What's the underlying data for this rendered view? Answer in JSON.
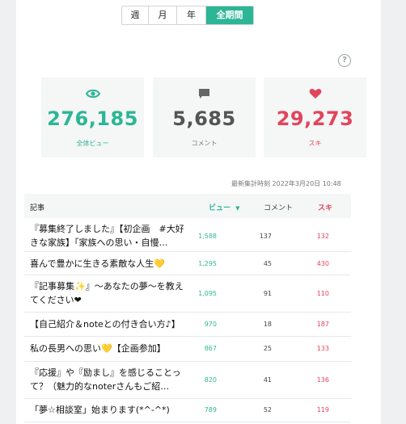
{
  "tabs": [
    {
      "label": "週",
      "active": false
    },
    {
      "label": "月",
      "active": false
    },
    {
      "label": "年",
      "active": false
    },
    {
      "label": "全期間",
      "active": true
    }
  ],
  "help": {
    "label": "?"
  },
  "stats": [
    {
      "value": "276,185",
      "label": "全体ビュー",
      "icon": "eye-icon",
      "color": "#2cb696"
    },
    {
      "value": "5,685",
      "label": "コメント",
      "icon": "comment-icon",
      "color": "#555555"
    },
    {
      "value": "29,273",
      "label": "スキ",
      "icon": "heart-icon",
      "color": "#e2445c"
    }
  ],
  "updated_at": "最新集計時刻 2022年3月20日 10:48",
  "table": {
    "headers": {
      "article": "記事",
      "views": "ビュー",
      "comments": "コメント",
      "likes": "スキ"
    },
    "rows": [
      {
        "title": "『募集終了しました』【初企画　#大好きな家族】「家族への思い・自慢…",
        "views": "1,588",
        "comments": "137",
        "likes": "132"
      },
      {
        "title": "喜んで豊かに生きる素敵な人生💛",
        "views": "1,295",
        "comments": "45",
        "likes": "430"
      },
      {
        "title": "『記事募集✨』〜あなたの夢〜を教えてください❤",
        "views": "1,095",
        "comments": "91",
        "likes": "110"
      },
      {
        "title": "【自己紹介＆noteとの付き合い方♪】",
        "views": "970",
        "comments": "18",
        "likes": "187"
      },
      {
        "title": "私の長男への思い💛【企画参加】",
        "views": "867",
        "comments": "25",
        "likes": "133"
      },
      {
        "title": "『応援』や『励まし』を感じることって？（魅力的なnoterさんもご紹…",
        "views": "820",
        "comments": "41",
        "likes": "136"
      },
      {
        "title": "「夢☆相談室」始まります(*^-^*)",
        "views": "789",
        "comments": "52",
        "likes": "119"
      }
    ]
  }
}
